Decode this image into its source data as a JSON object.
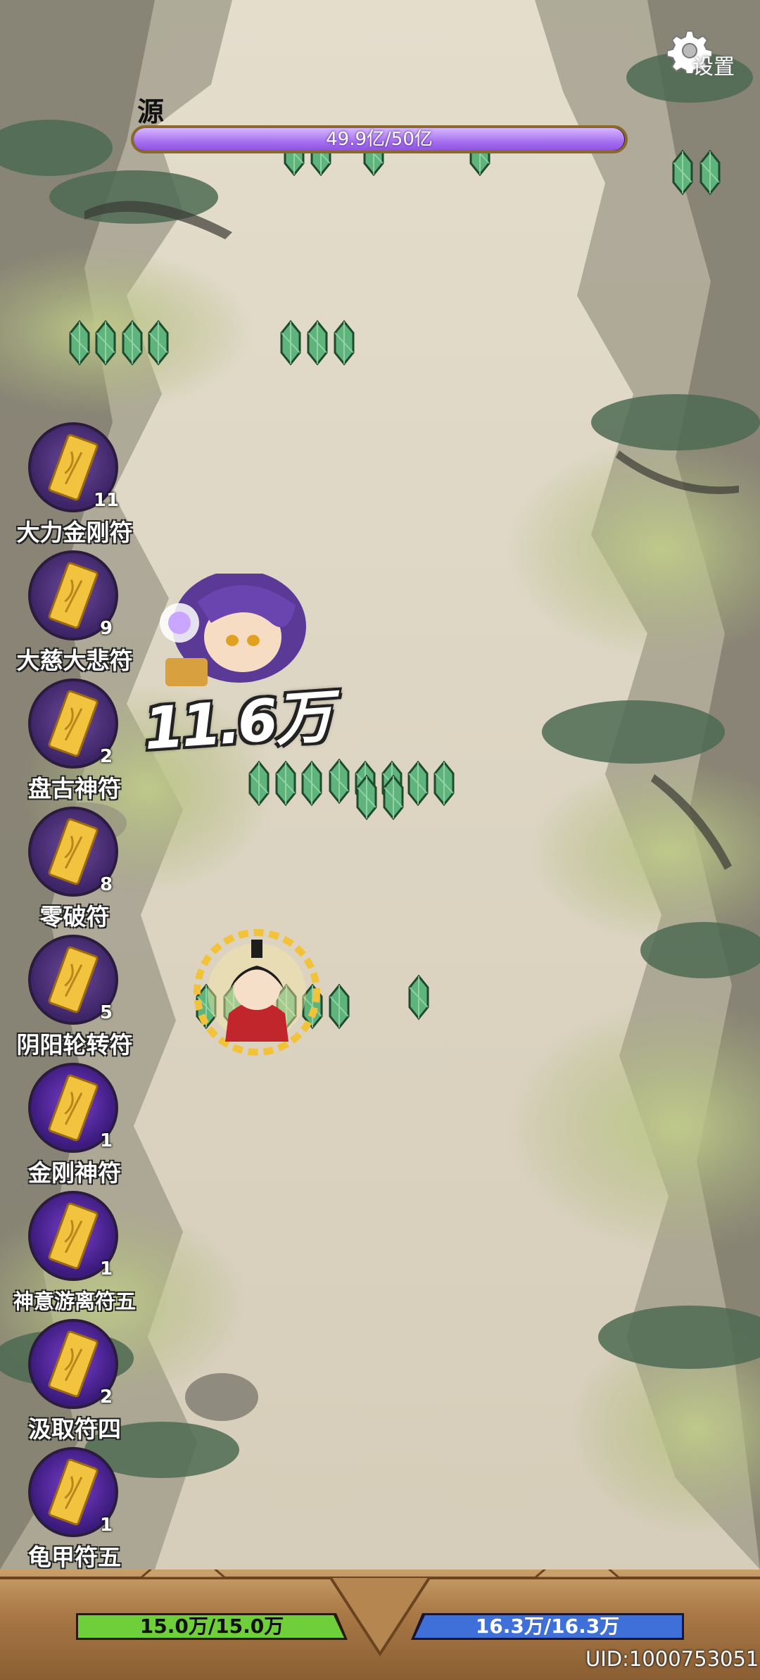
{
  "boss": {
    "name": "源",
    "hp_text": "49.9亿/50亿",
    "hp_fraction": 0.998
  },
  "settings": {
    "label": "设置",
    "icon": "gear-icon"
  },
  "damage_popup": "11.6万",
  "talismans": [
    {
      "name": "大力金刚符",
      "count": "11"
    },
    {
      "name": "大慈大悲符",
      "count": "9"
    },
    {
      "name": "盘古神符",
      "count": "2"
    },
    {
      "name": "零破符",
      "count": "8"
    },
    {
      "name": "阴阳轮转符",
      "count": "5"
    },
    {
      "name": "金刚神符",
      "count": "1"
    },
    {
      "name": "神意游离符五",
      "count": "1"
    },
    {
      "name": "汲取符四",
      "count": "2"
    },
    {
      "name": "龟甲符五",
      "count": "1"
    }
  ],
  "player": {
    "hp_text": "15.0万/15.0万",
    "mp_text": "16.3万/16.3万",
    "uid": "UID:1000753051"
  },
  "colors": {
    "boss_bar": "#a770f0",
    "hp_bar": "#6fcf3a",
    "mp_bar": "#3f6fd8",
    "crystal": "#4fa86a"
  }
}
